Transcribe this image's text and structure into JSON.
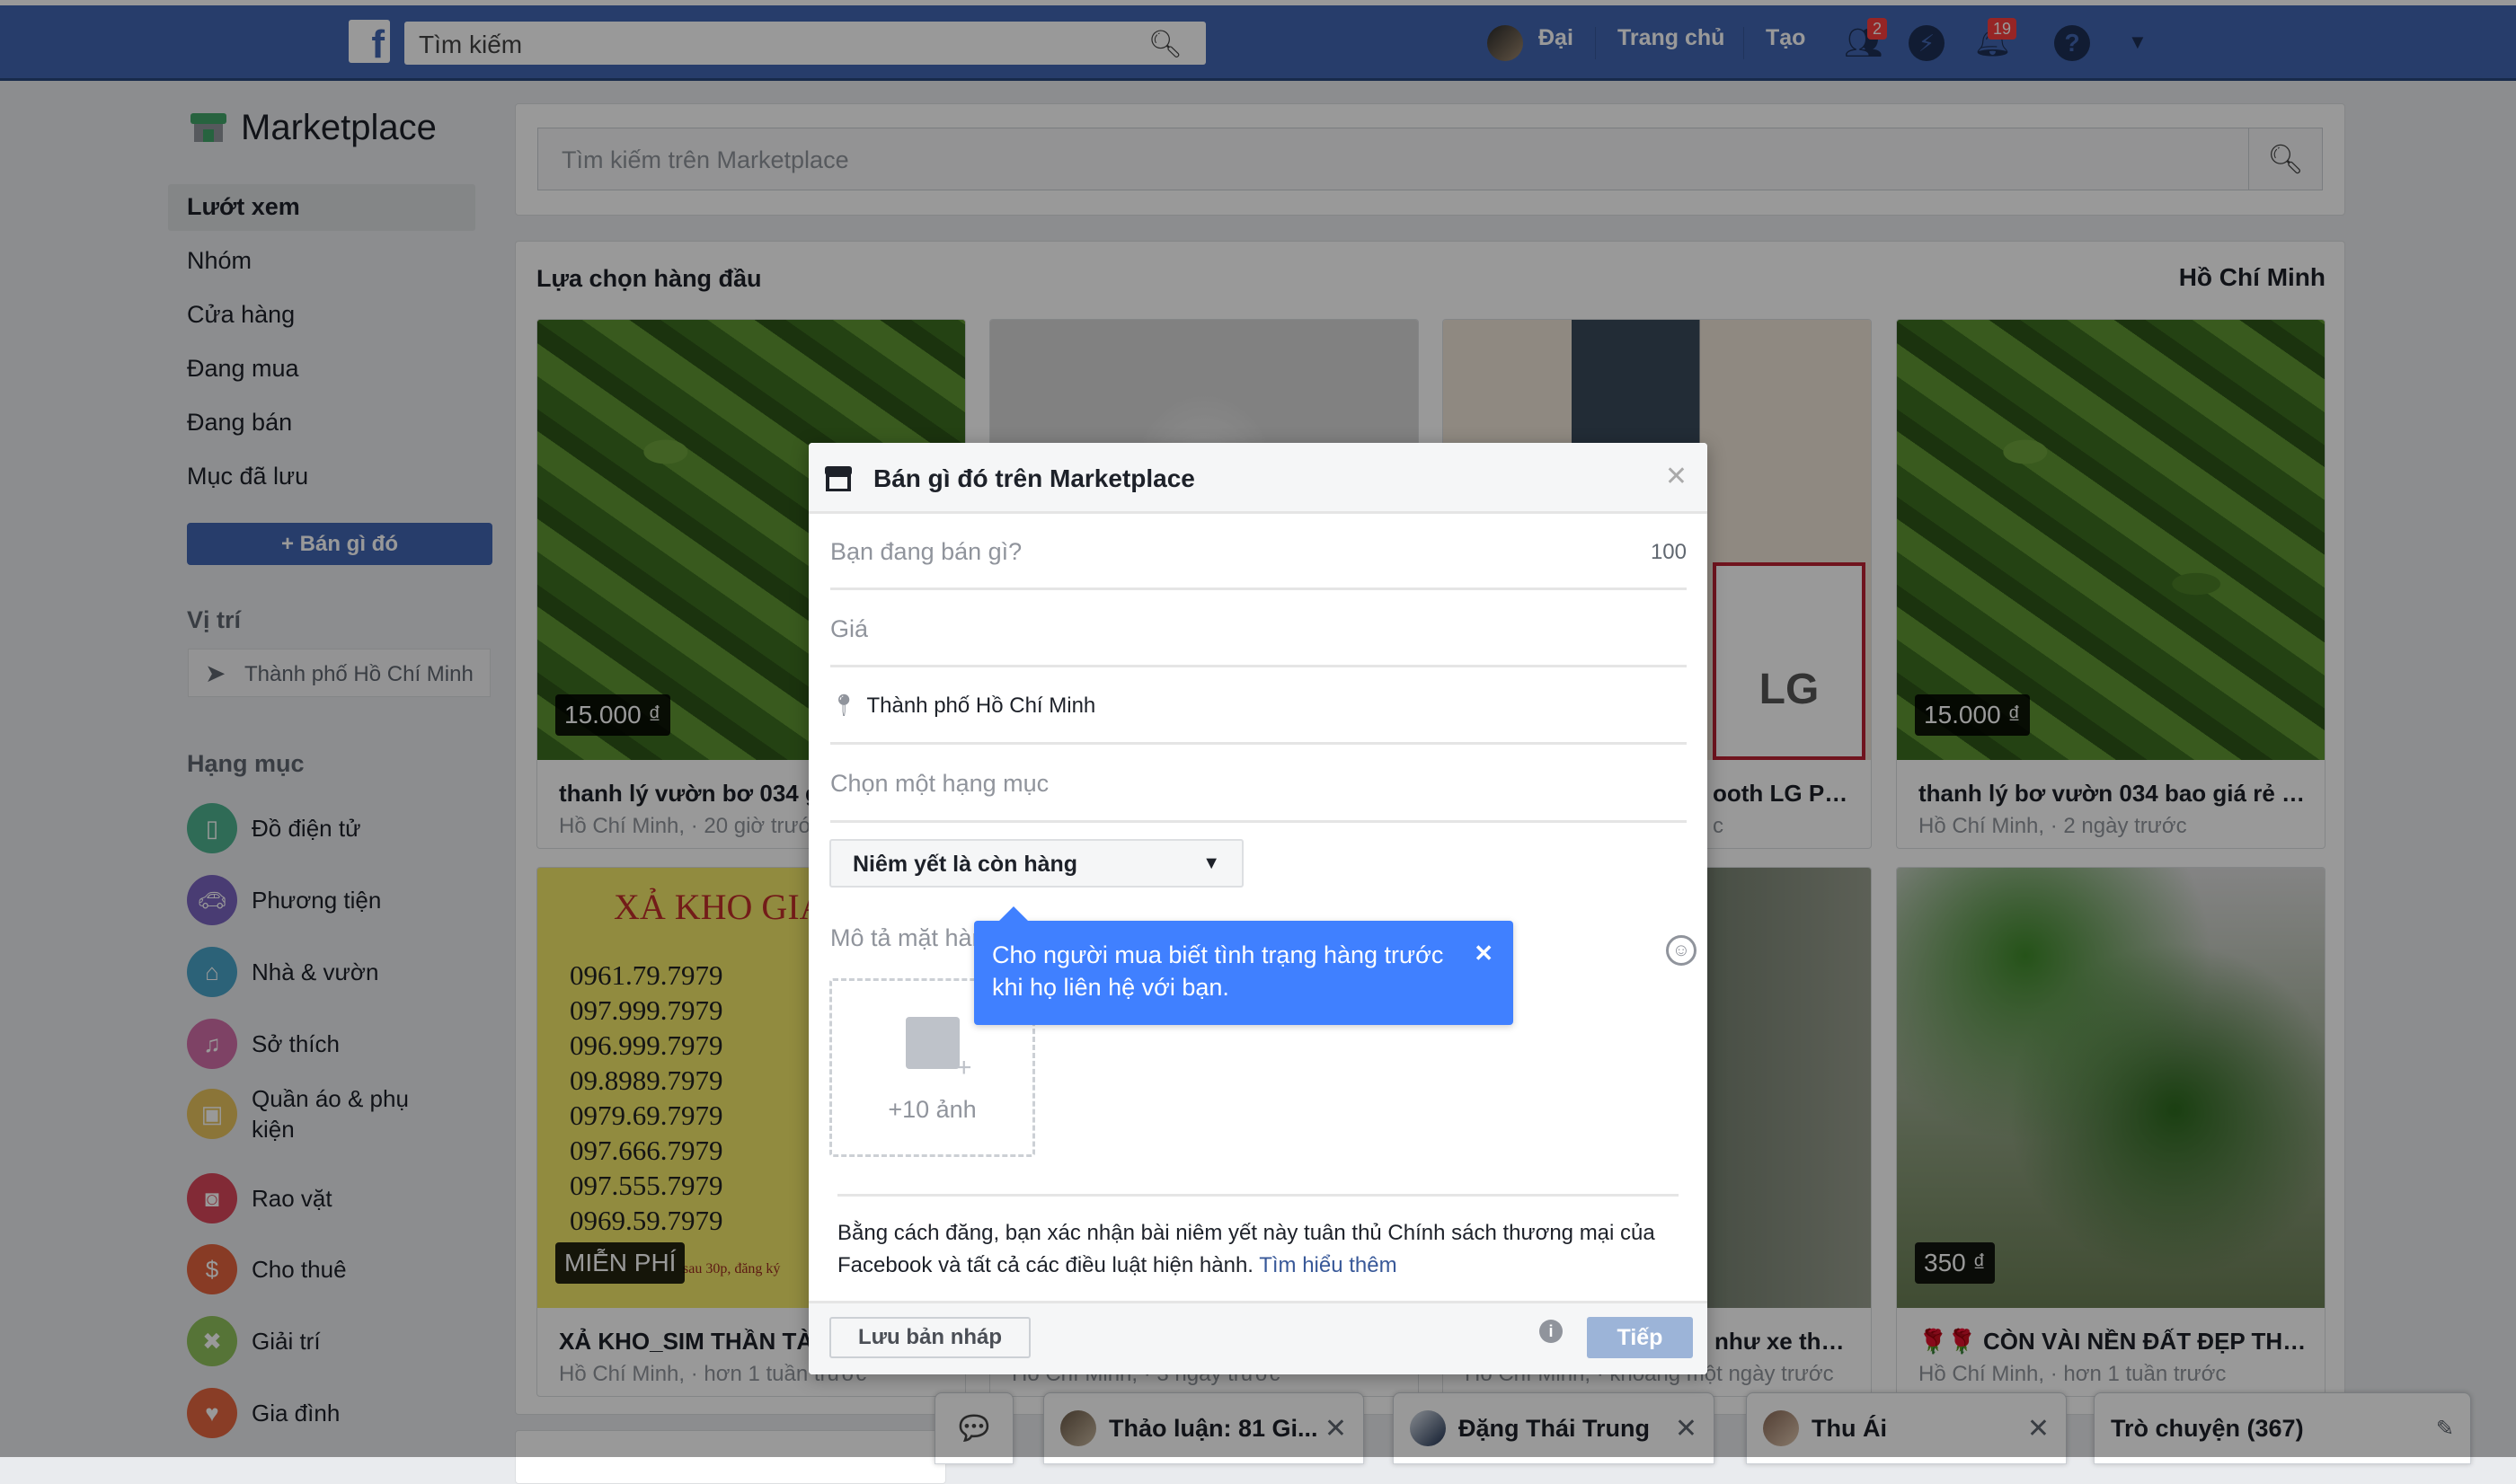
{
  "navbar": {
    "search_placeholder": "Tìm kiếm",
    "user_name": "Đại",
    "home": "Trang chủ",
    "create": "Tạo",
    "friend_requests_badge": "2",
    "notifications_badge": "19",
    "brand_color": "#4267b2"
  },
  "sidebar": {
    "title": "Marketplace",
    "nav": [
      "Lướt xem",
      "Nhóm",
      "Cửa hàng",
      "Đang mua",
      "Đang bán",
      "Mục đã lưu"
    ],
    "active_nav": "Lướt xem",
    "sell_button": "+ Bán gì đó",
    "location_heading": "Vị trí",
    "location_value": "Thành phố Hồ Chí Minh",
    "categories_heading": "Hạng mục",
    "categories": [
      {
        "label": "Đồ điện tử",
        "icon": "tablet-icon",
        "color": "#4fb290"
      },
      {
        "label": "Phương tiện",
        "icon": "car-icon",
        "color": "#7b64c0"
      },
      {
        "label": "Nhà & vườn",
        "icon": "house-icon",
        "color": "#4aa3c9"
      },
      {
        "label": "Sở thích",
        "icon": "guitar-icon",
        "color": "#d36fa8"
      },
      {
        "label": "Quần áo & phụ kiện",
        "icon": "backpack-icon",
        "color": "#e8c35e"
      },
      {
        "label": "Rao vặt",
        "icon": "binoculars-icon",
        "color": "#d9465a"
      },
      {
        "label": "Cho thuê",
        "icon": "rent-house-icon",
        "color": "#e3633f"
      },
      {
        "label": "Giải trí",
        "icon": "gamepad-icon",
        "color": "#8fc25d"
      },
      {
        "label": "Gia đình",
        "icon": "heart-icon",
        "color": "#e56740"
      }
    ]
  },
  "main": {
    "search_placeholder": "Tìm kiếm trên Marketplace",
    "section_title": "Lựa chọn hàng đầu",
    "section_location": "Hồ Chí Minh",
    "listings": [
      {
        "title": "thanh lý vườn bơ 034 g",
        "subtitle": "Hồ Chí Minh, · 20 giờ trước",
        "price": "15.000 ₫"
      },
      {
        "title": "",
        "subtitle": "",
        "price": ""
      },
      {
        "title": "ooth LG PK...",
        "subtitle": "c",
        "price": ""
      },
      {
        "title": "thanh lý bơ vườn 034 bao giá rẻ n...",
        "subtitle": "Hồ Chí Minh, · 2 ngày trước",
        "price": "15.000 ₫"
      },
      {
        "title": "XẢ KHO_SIM THẦN TÀI",
        "subtitle": "Hồ Chí Minh, · hơn 1 tuần trước",
        "price": "MIỄN PHÍ"
      },
      {
        "title": "",
        "subtitle": "Hồ Chí Minh, · 3 ngày trước",
        "price": ""
      },
      {
        "title": "như xe thù...",
        "subtitle": "Hồ Chí Minh, · khoảng một ngày trước",
        "price": ""
      },
      {
        "title": "🌹🌹 CÒN VÀI NỀN ĐẤT ĐẸP THỈ...",
        "subtitle": "Hồ Chí Minh, · hơn 1 tuần trước",
        "price": "350 ₫"
      }
    ],
    "sim_image": {
      "heading": "XẢ KHO GIÁ",
      "numbers": [
        "0961.79.7979",
        "097.999.7979",
        "096.999.7979",
        "09.8989.7979",
        "0979.69.7979",
        "097.666.7979",
        "097.555.7979",
        "0969.59.7979"
      ],
      "footer": "sau 30p, đăng ký"
    },
    "speaker_box_label": "LG"
  },
  "modal": {
    "title": "Bán gì đó trên Marketplace",
    "item_placeholder": "Bạn đang bán gì?",
    "char_limit": "100",
    "price_placeholder": "Giá",
    "location": "Thành phố Hồ Chí Minh",
    "category_placeholder": "Chọn một hạng mục",
    "availability": "Niêm yết là còn hàng",
    "description_placeholder": "Mô tả mặt hàng",
    "photos_label": "+10 ảnh",
    "disclaimer_line1": "Bằng cách đăng, bạn xác nhận bài niêm yết này tuân thủ Chính sách thương mại của",
    "disclaimer_line2": "Facebook và tất cả các điều luật hiện hành.",
    "learn_more": "Tìm hiểu thêm",
    "save_draft": "Lưu bản nháp",
    "next": "Tiếp"
  },
  "tooltip": {
    "text": "Cho người mua biết tình trạng hàng trước khi họ liên hệ với bạn."
  },
  "chat": {
    "tabs": [
      {
        "name": "Thảo luận: 81 Gi..."
      },
      {
        "name": "Đặng Thái Trung"
      },
      {
        "name": "Thu Ái"
      }
    ],
    "chat_list": "Trò chuyện (367)"
  }
}
